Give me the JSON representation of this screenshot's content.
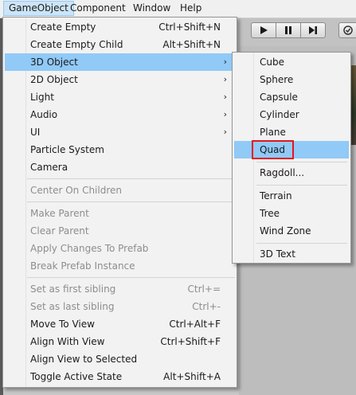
{
  "menubar": {
    "items": [
      {
        "label": "GameObject"
      },
      {
        "label": "Component"
      },
      {
        "label": "Window"
      },
      {
        "label": "Help"
      }
    ]
  },
  "gameobject_menu": {
    "items": [
      {
        "label": "Create Empty",
        "shortcut": "Ctrl+Shift+N",
        "enabled": true
      },
      {
        "label": "Create Empty Child",
        "shortcut": "Alt+Shift+N",
        "enabled": true
      },
      {
        "label": "3D Object",
        "has_submenu": true,
        "highlighted": true
      },
      {
        "label": "2D Object",
        "has_submenu": true
      },
      {
        "label": "Light",
        "has_submenu": true
      },
      {
        "label": "Audio",
        "has_submenu": true
      },
      {
        "label": "UI",
        "has_submenu": true
      },
      {
        "label": "Particle System"
      },
      {
        "label": "Camera"
      },
      {
        "label": "Center On Children",
        "enabled": false
      },
      {
        "label": "Make Parent",
        "enabled": false
      },
      {
        "label": "Clear Parent",
        "enabled": false
      },
      {
        "label": "Apply Changes To Prefab",
        "enabled": false
      },
      {
        "label": "Break Prefab Instance",
        "enabled": false
      },
      {
        "label": "Set as first sibling",
        "shortcut": "Ctrl+=",
        "enabled": false
      },
      {
        "label": "Set as last sibling",
        "shortcut": "Ctrl+-",
        "enabled": false
      },
      {
        "label": "Move To View",
        "shortcut": "Ctrl+Alt+F"
      },
      {
        "label": "Align With View",
        "shortcut": "Ctrl+Shift+F"
      },
      {
        "label": "Align View to Selected"
      },
      {
        "label": "Toggle Active State",
        "shortcut": "Alt+Shift+A"
      }
    ],
    "submenu_arrow": "›"
  },
  "object3d_submenu": {
    "items": [
      {
        "label": "Cube"
      },
      {
        "label": "Sphere"
      },
      {
        "label": "Capsule"
      },
      {
        "label": "Cylinder"
      },
      {
        "label": "Plane"
      },
      {
        "label": "Quad",
        "highlighted": true,
        "annotated": true
      },
      {
        "label": "Ragdoll..."
      },
      {
        "label": "Terrain"
      },
      {
        "label": "Tree"
      },
      {
        "label": "Wind Zone"
      },
      {
        "label": "3D Text"
      }
    ]
  },
  "toolbar": {
    "play_icon": "play-icon",
    "pause_icon": "pause-icon",
    "step_icon": "step-icon"
  },
  "colors": {
    "highlight": "#91c9f7",
    "annotation": "#e8141e",
    "disabled_text": "#8d8d8d"
  }
}
